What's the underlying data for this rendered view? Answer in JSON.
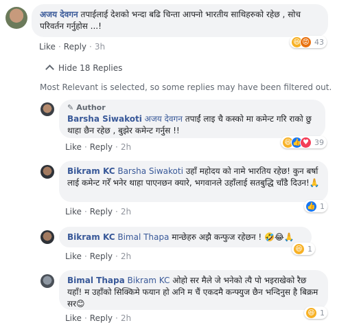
{
  "comment_main": {
    "author": "अजय देवगन",
    "text": "तपाईलाई देशको भन्दा बढि चिन्ता आफ्नो भारतीय साथिहरुको रहेछ , सोच परिवर्तन गर्नुहोस ...!",
    "like": "Like",
    "reply": "Reply",
    "time": "3h",
    "reaction_count": "43"
  },
  "hide_replies": "Hide 18 Replies",
  "notice": "Most Relevant is selected, so some replies may have been filtered out.",
  "replies": [
    {
      "badge": "Author",
      "author": "Barsha Siwakoti",
      "tag": "अजय देवगन",
      "text": " तपाईं लाइ चै कस्को मा कमेन्ट गरि राको छु थाहा छैन रहेछ , बुझेर कमेन्ट गर्नुस !!",
      "like": "Like",
      "reply": "Reply",
      "time": "2h",
      "reaction_count": "39"
    },
    {
      "author": "Bikram KC",
      "tag": "Barsha Siwakoti",
      "text": " उहाँ महोदय को नामे भारतिय रहेछ! कुन बर्षा लाई कमेन्ट गरेँ भनेर थाहा पाएनछन क्यारे, भगवानले उहाँलाई सतबुद्धि चाँडै दिउन!🙏",
      "like": "Like",
      "reply": "Reply",
      "time": "2h",
      "reaction_count": "1"
    },
    {
      "author": "Bikram KC",
      "tag": "Bimal Thapa",
      "text": " मान्छेहरु अझै कन्फुज रहेछन ! 🤣😂🙏",
      "like": "Like",
      "reply": "Reply",
      "time": "2h",
      "reaction_count": "1"
    },
    {
      "author": "Bimal Thapa",
      "tag": "Bikram KC",
      "text": " ओहो सर मैले जे भनेको त्यै पो भइराखेको रैछ यहाँ! म उहाँको सिक्किमे फयान हो अनि म चैं एकदमै कन्फ्युज छैन भन्दिनुस है बिक्रम सर😊",
      "like": "Like",
      "reply": "Reply",
      "time": "2h",
      "reaction_count": "1"
    }
  ],
  "colors": {
    "link": "#385898",
    "bubble": "#f2f3f5",
    "meta": "#90949c"
  }
}
